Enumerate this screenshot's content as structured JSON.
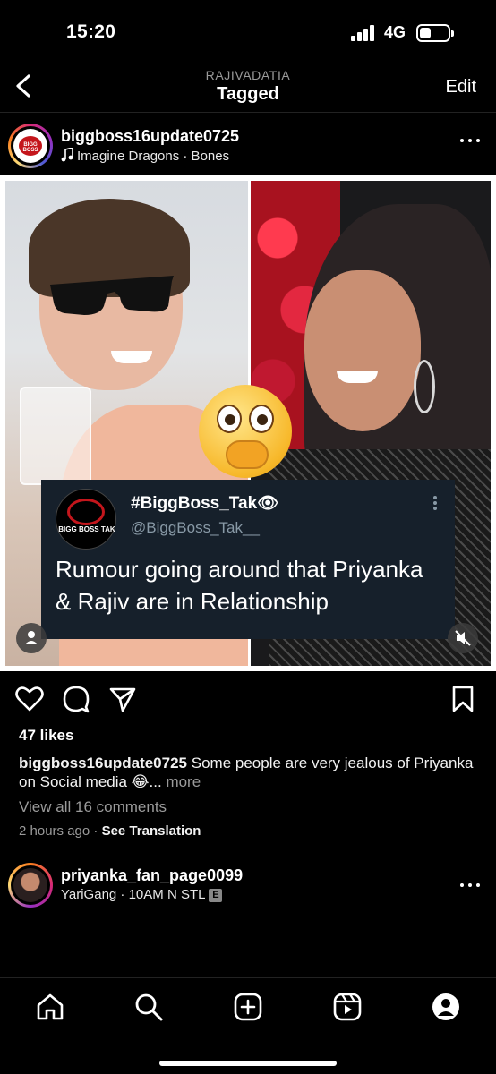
{
  "status": {
    "time": "15:20",
    "network": "4G"
  },
  "header": {
    "subtitle": "RAJIVADATIA",
    "title": "Tagged",
    "edit_label": "Edit"
  },
  "post": {
    "username": "biggboss16update0725",
    "music": "Imagine Dragons · Bones",
    "avatar_logo_text": "BIGG BOSS",
    "tweet": {
      "name": "#BiggBoss_Tak👁",
      "handle": "@BiggBoss_Tak__",
      "avatar_text": "BIGG BOSS TAK",
      "body": "Rumour going around that Priyanka & Rajiv are in Relationship"
    },
    "likes": "47 likes",
    "caption_user": "biggboss16update0725",
    "caption_text": " Some people are very jealous of Priyanka on Social media 😂...",
    "caption_more": " more",
    "view_comments": "View all 16 comments",
    "time_ago": "2 hours ago",
    "separator": " · ",
    "see_translation": "See Translation"
  },
  "next_post": {
    "username": "priyanka_fan_page0099",
    "subtitle": "YariGang · 10AM N STL",
    "badge": "E"
  },
  "tabs": [
    "home",
    "search",
    "create",
    "reels",
    "profile"
  ],
  "colors": {
    "background": "#000000",
    "secondary_text": "#9a9a9a",
    "tweet_bg": "#16202b"
  }
}
